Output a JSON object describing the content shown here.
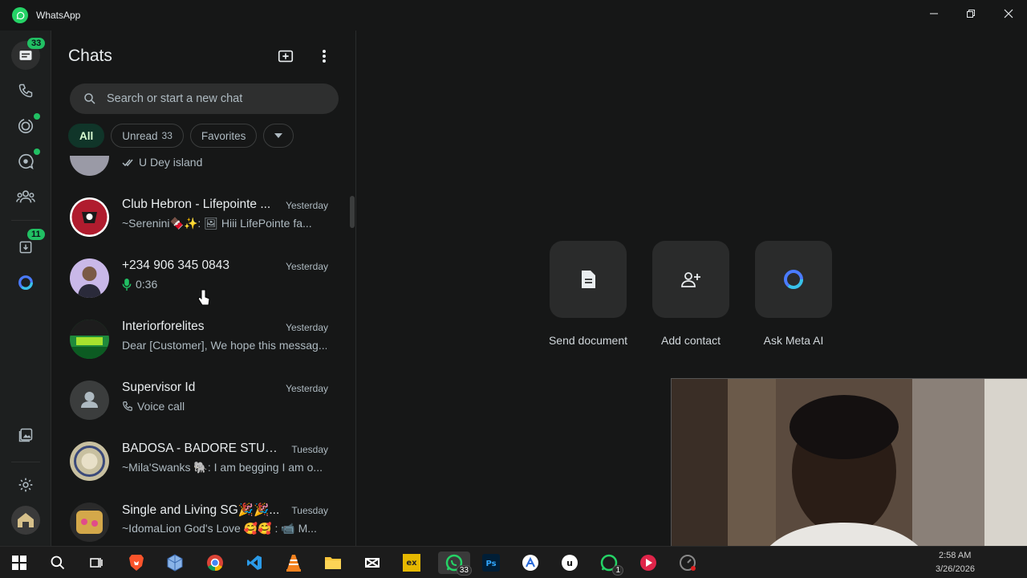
{
  "app": {
    "title": "WhatsApp"
  },
  "rail": {
    "chats_badge": "33",
    "updates_badge": "11"
  },
  "chat_panel": {
    "title": "Chats",
    "search_placeholder": "Search or start a new chat",
    "filters": [
      {
        "label": "All",
        "active": true
      },
      {
        "label": "Unread",
        "count": "33"
      },
      {
        "label": "Favorites"
      }
    ]
  },
  "chats": [
    {
      "name": "",
      "time": "",
      "preview": "U Dey island",
      "preview_icon": "double-check-icon",
      "avatar_color": "#9a9aa6"
    },
    {
      "name": "Club Hebron -  Lifepointe ...",
      "time": "Yesterday",
      "preview": "~Serenini🍫✨: 🖼 Hiii LifePointe fa...",
      "avatar_color": "#b01c2e"
    },
    {
      "name": "+234 906 345 0843",
      "time": "Yesterday",
      "preview": "0:36",
      "preview_icon": "mic-icon",
      "avatar_color": "#c9b8e8"
    },
    {
      "name": "Interiorforelites",
      "time": "Yesterday",
      "preview": "Dear [Customer], We hope this messag...",
      "avatar_color": "#1f8a3c"
    },
    {
      "name": "Supervisor Id",
      "time": "Yesterday",
      "preview": "Voice call",
      "preview_icon": "phone-icon",
      "avatar_color": "#3b3d3d"
    },
    {
      "name": "BADOSA - BADORE STUDE...",
      "time": "Tuesday",
      "preview": "~Mila'Swanks 🐘: I am begging  I am o...",
      "avatar_color": "#c8c0a0"
    },
    {
      "name": "Single and Living SG🎉🎉...",
      "time": "Tuesday",
      "preview": "~IdomaLion God's Love 🥰🥰 : 📹 M...",
      "avatar_color": "#2a2a2a"
    }
  ],
  "main": {
    "actions": [
      {
        "label": "Send document",
        "icon": "document-icon"
      },
      {
        "label": "Add contact",
        "icon": "add-contact-icon"
      },
      {
        "label": "Ask Meta AI",
        "icon": "meta-ai-icon"
      }
    ]
  },
  "taskbar": {
    "whatsapp_badge": "33",
    "whatsapp2_badge": "1",
    "time": "2:58 AM",
    "date": "3/26/2026"
  }
}
